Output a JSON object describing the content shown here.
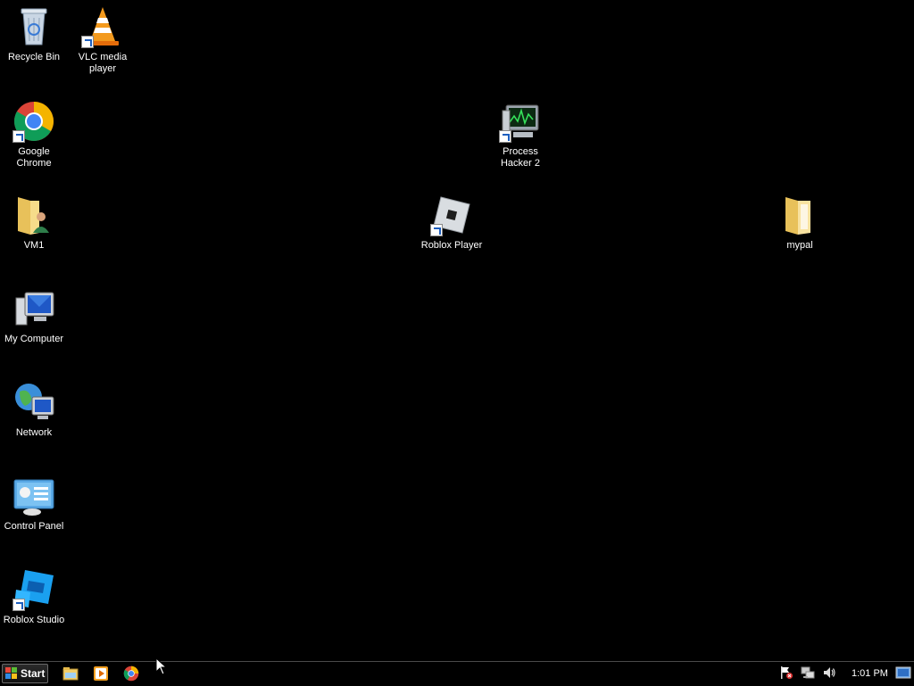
{
  "desktop": {
    "icons": [
      {
        "id": "recycle_bin",
        "label": "Recycle Bin",
        "icon": "recycle-bin-icon"
      },
      {
        "id": "vlc",
        "label": "VLC media player",
        "icon": "vlc-icon"
      },
      {
        "id": "chrome",
        "label": "Google Chrome",
        "icon": "chrome-icon"
      },
      {
        "id": "process_hacker",
        "label": "Process Hacker 2",
        "icon": "process-hacker-icon"
      },
      {
        "id": "vm1",
        "label": "VM1",
        "icon": "user-folder-icon"
      },
      {
        "id": "roblox_player",
        "label": "Roblox Player",
        "icon": "roblox-player-icon"
      },
      {
        "id": "mypal",
        "label": "mypal",
        "icon": "folder-icon"
      },
      {
        "id": "my_computer",
        "label": "My Computer",
        "icon": "computer-icon"
      },
      {
        "id": "network",
        "label": "Network",
        "icon": "network-icon"
      },
      {
        "id": "control_panel",
        "label": "Control Panel",
        "icon": "control-panel-icon"
      },
      {
        "id": "roblox_studio",
        "label": "Roblox Studio",
        "icon": "roblox-studio-icon"
      }
    ]
  },
  "taskbar": {
    "start_label": "Start",
    "quick_launch": [
      "file-explorer-icon",
      "media-player-icon",
      "chrome-icon"
    ],
    "tray": [
      "action-center-flag-icon",
      "network-status-icon",
      "volume-icon"
    ],
    "clock": "1:01 PM"
  },
  "colors": {
    "background": "#000000",
    "taskbar": "#000000",
    "label": "#ffffff"
  }
}
